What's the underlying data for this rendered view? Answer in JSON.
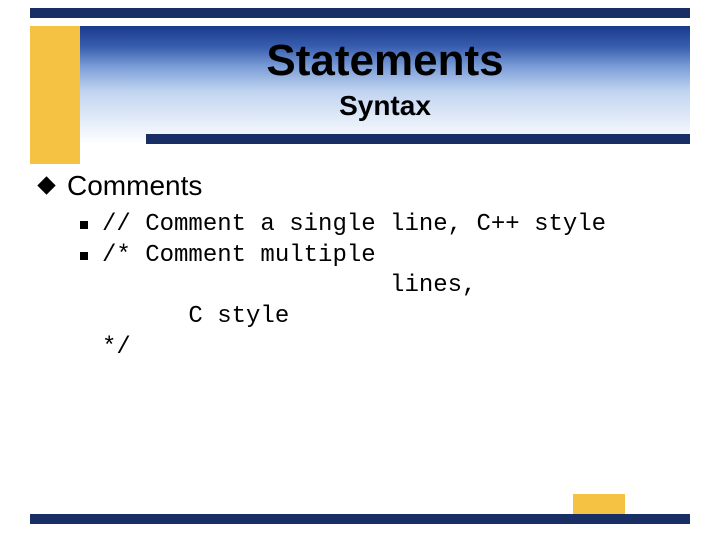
{
  "title": "Statements",
  "subtitle": "Syntax",
  "section": {
    "heading": "Comments",
    "items": [
      "// Comment a single line, C++ style",
      "/* Comment multiple\n                    lines,\n      C style\n*/"
    ]
  }
}
